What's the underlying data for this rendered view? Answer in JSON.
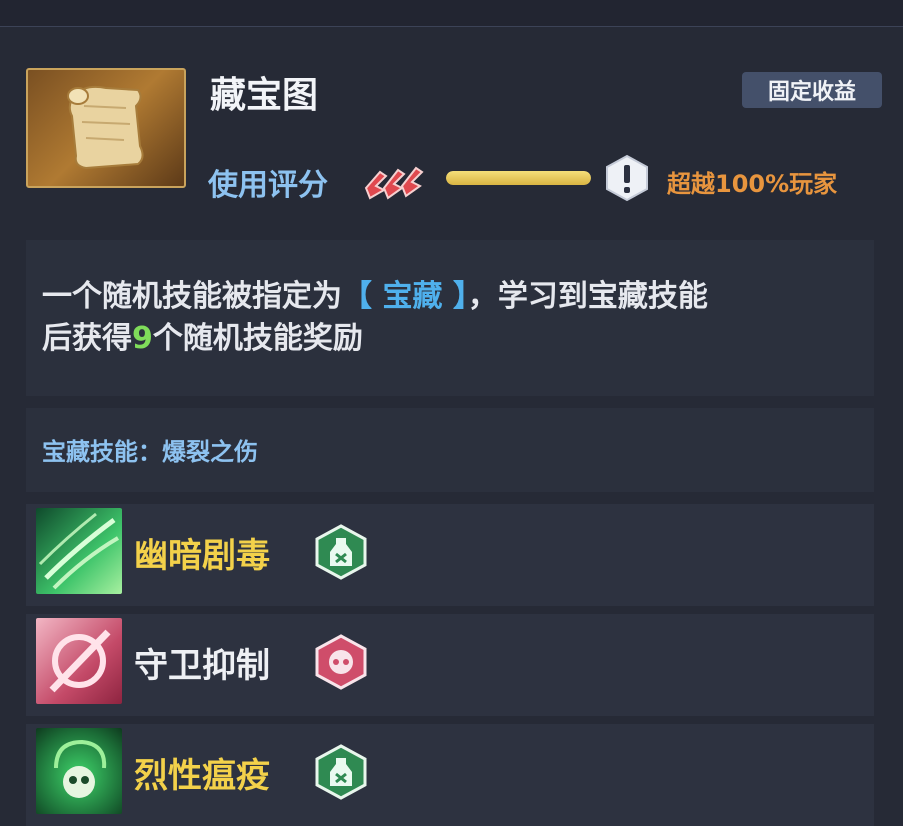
{
  "item": {
    "icon": "treasure-map-scroll",
    "title": "藏宝图",
    "badge": "固定收益",
    "score_label": "使用评分",
    "rank": "SSS",
    "score_fraction": 1.0,
    "surpass": "超越100%玩家"
  },
  "description": {
    "line1_a": "一个随机技能被指定为",
    "line1_bracket": "【 宝藏 】",
    "line1_b": "，学习到宝藏技能",
    "line2_a": "后获得",
    "line2_num": "9",
    "line2_b": "个随机技能奖励"
  },
  "treasure_skill_label": "宝藏技能：爆裂之伤",
  "skills": [
    {
      "name": "幽暗剧毒",
      "icon": "dark-poison-claw-icon",
      "badge_icon": "poison-bottle-hex-icon",
      "name_color": "#f3d14a"
    },
    {
      "name": "守卫抑制",
      "icon": "guard-suppress-icon",
      "badge_icon": "target-hex-icon",
      "name_color": "#eef0f4"
    },
    {
      "name": "烈性瘟疫",
      "icon": "plague-skull-icon",
      "badge_icon": "poison-bottle-hex-icon",
      "name_color": "#f3d14a"
    }
  ]
}
